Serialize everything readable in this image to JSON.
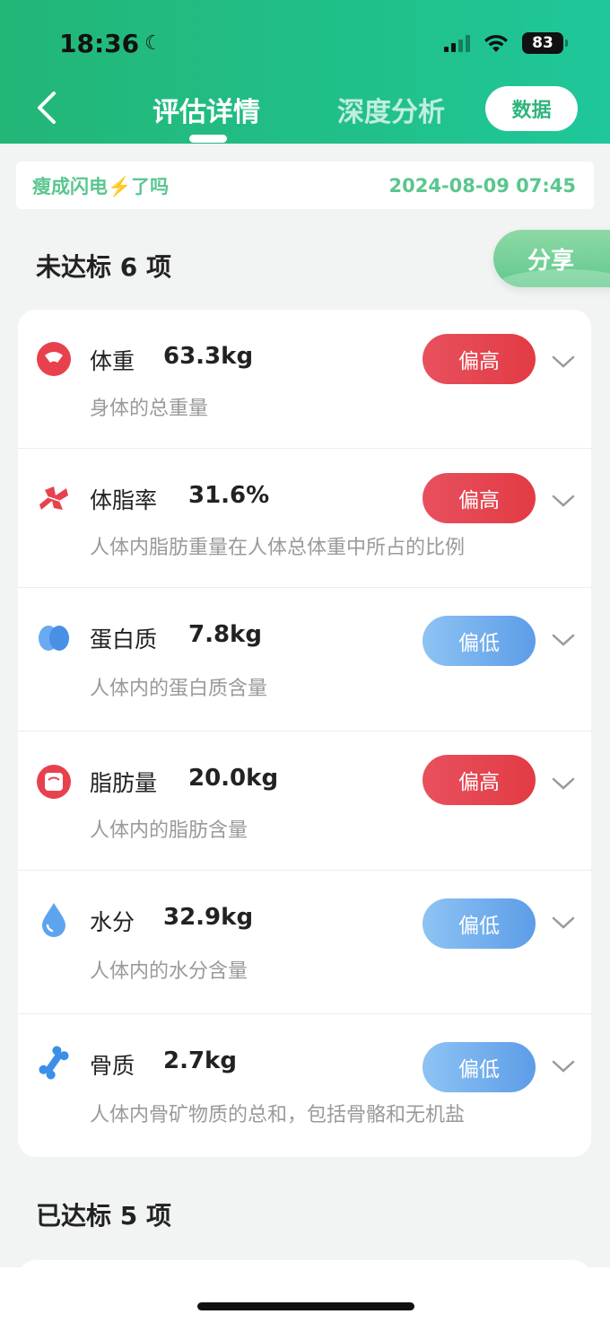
{
  "status_bar": {
    "time": "18:36",
    "battery": "83"
  },
  "nav": {
    "tab_active": "评估详情",
    "tab_inactive": "深度分析",
    "data_button": "数据"
  },
  "info": {
    "user": "瘦成闪电⚡️了吗",
    "datetime": "2024-08-09 07:45"
  },
  "share_label": "分享",
  "unmet": {
    "title": "未达标 6 项",
    "items": [
      {
        "name": "体重",
        "value": "63.3kg",
        "desc": "身体的总重量",
        "status": "偏高",
        "level": "high",
        "icon": "weight-scale-icon"
      },
      {
        "name": "体脂率",
        "value": "31.6%",
        "desc": "人体内脂肪重量在人体总体重中所占的比例",
        "status": "偏高",
        "level": "high",
        "icon": "body-fat-icon"
      },
      {
        "name": "蛋白质",
        "value": "7.8kg",
        "desc": "人体内的蛋白质含量",
        "status": "偏低",
        "level": "low",
        "icon": "protein-icon"
      },
      {
        "name": "脂肪量",
        "value": "20.0kg",
        "desc": "人体内的脂肪含量",
        "status": "偏高",
        "level": "high",
        "icon": "fat-scale-icon"
      },
      {
        "name": "水分",
        "value": "32.9kg",
        "desc": "人体内的水分含量",
        "status": "偏低",
        "level": "low",
        "icon": "water-drop-icon"
      },
      {
        "name": "骨质",
        "value": "2.7kg",
        "desc": "人体内骨矿物质的总和，包括骨骼和无机盐",
        "status": "偏低",
        "level": "low",
        "icon": "bone-icon"
      }
    ]
  },
  "met": {
    "title": "已达标 5 项"
  },
  "colors": {
    "accent_green": "#22b677",
    "high_red": "#e23b44",
    "low_blue": "#5d9de8"
  }
}
